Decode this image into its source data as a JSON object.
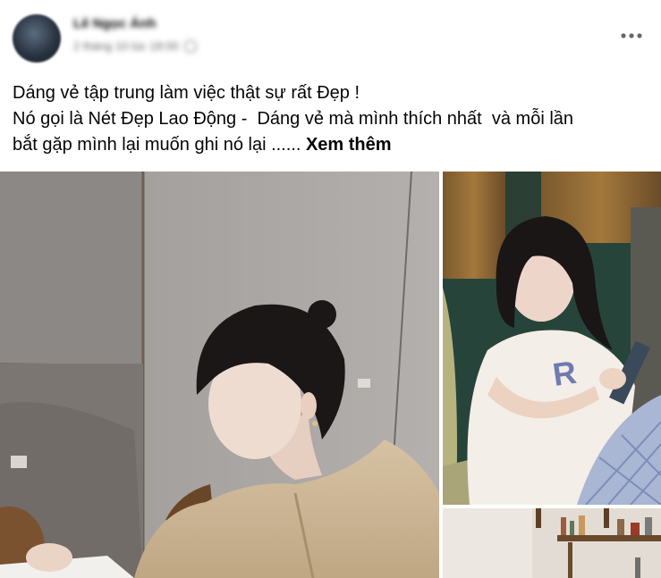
{
  "post": {
    "author_name": "Lê Ngọc Ánh",
    "timestamp": "2 tháng 10 lúc 18:00",
    "text_lines": [
      "Dáng vẻ tập trung làm việc thật sự rất Đẹp !",
      "Nó gọi là Nét Đẹp Lao Động -  Dáng vẻ mà mình thích nhất  và mỗi lần",
      "bắt gặp mình lại muốn ghi nó lại ...... "
    ],
    "see_more_label": "Xem thêm",
    "icons": {
      "more": "more-horizontal-icon",
      "privacy": "globe-icon"
    },
    "colors": {
      "text": "#050505",
      "secondary_text": "#65676b",
      "background": "#ffffff"
    }
  }
}
